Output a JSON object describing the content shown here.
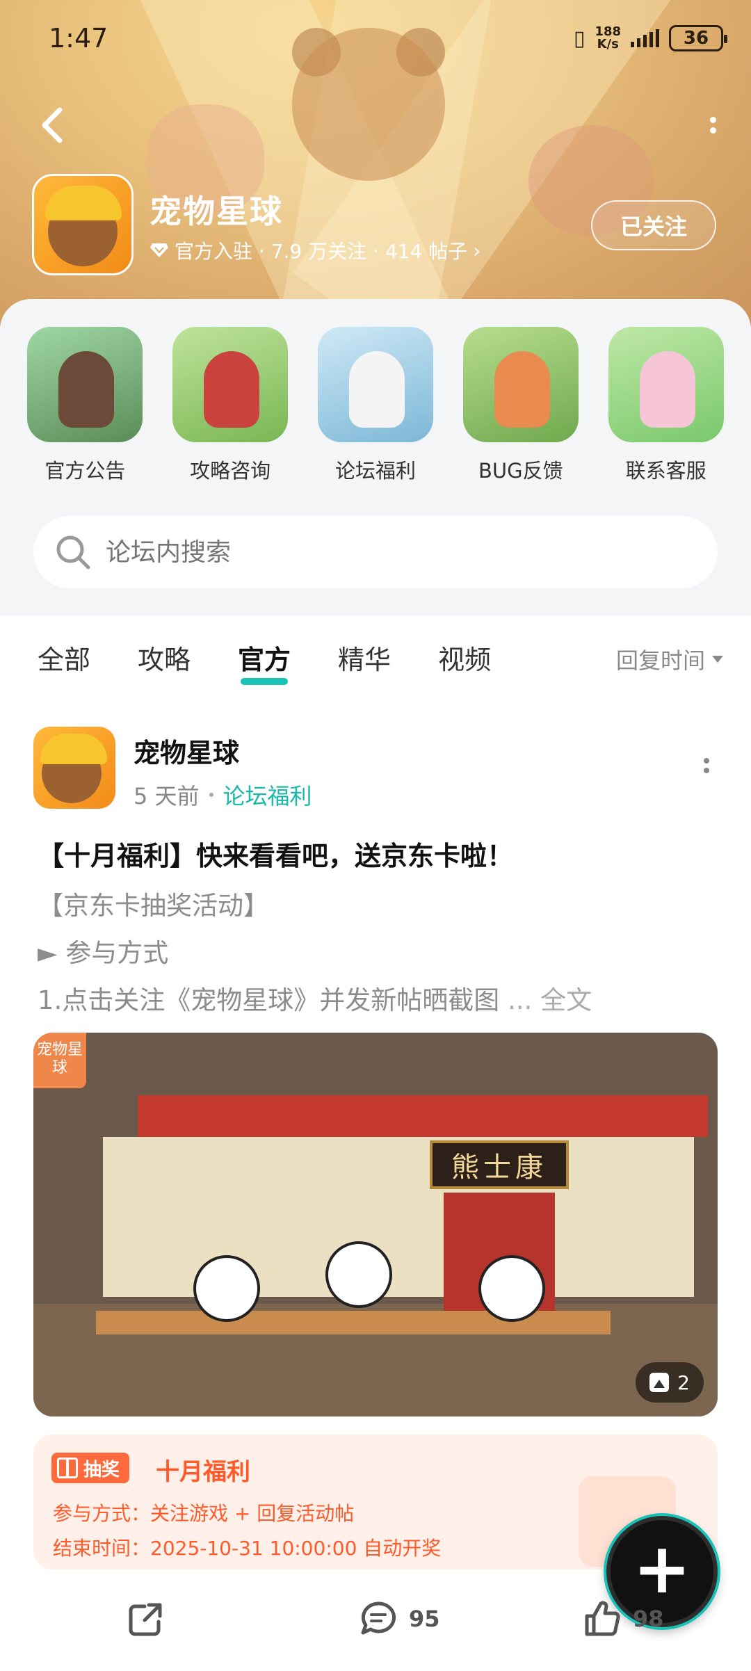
{
  "status_bar": {
    "time": "1:47",
    "net_speed": "188",
    "net_unit": "K/s",
    "battery": "36"
  },
  "forum": {
    "name": "宠物星球",
    "meta": "官方入驻 · 7.9 万关注 · 414 帖子",
    "follow_label": "已关注"
  },
  "shortcuts": [
    {
      "label": "官方公告"
    },
    {
      "label": "攻略咨询"
    },
    {
      "label": "论坛福利"
    },
    {
      "label": "BUG反馈"
    },
    {
      "label": "联系客服"
    }
  ],
  "search": {
    "placeholder": "论坛内搜索"
  },
  "tabs": [
    {
      "label": "全部"
    },
    {
      "label": "攻略"
    },
    {
      "label": "官方",
      "active": true
    },
    {
      "label": "精华"
    },
    {
      "label": "视频"
    }
  ],
  "sort_label": "回复时间",
  "post": {
    "author": "宠物星球",
    "time": "5 天前",
    "board": "论坛福利",
    "title": "【十月福利】快来看看吧，送京东卡啦！",
    "line1": "【京东卡抽奖活动】",
    "line2": "► 参与方式",
    "line3": "1.点击关注《宠物星球》并发新帖晒截图",
    "ellipsis": " ... ",
    "full_text": "全文",
    "image_badge": "宠物星球",
    "image_sign": "熊士康",
    "image_count": "2",
    "lottery": {
      "tag": "抽奖",
      "title": "十月福利",
      "method": "参与方式：关注游戏 + 回复活动帖",
      "end_time": "结束时间：2025-10-31 10:00:00 自动开奖"
    },
    "comments": "95",
    "likes": "98"
  },
  "colors": {
    "accent": "#19c2b6",
    "lottery": "#ff5a2a"
  }
}
